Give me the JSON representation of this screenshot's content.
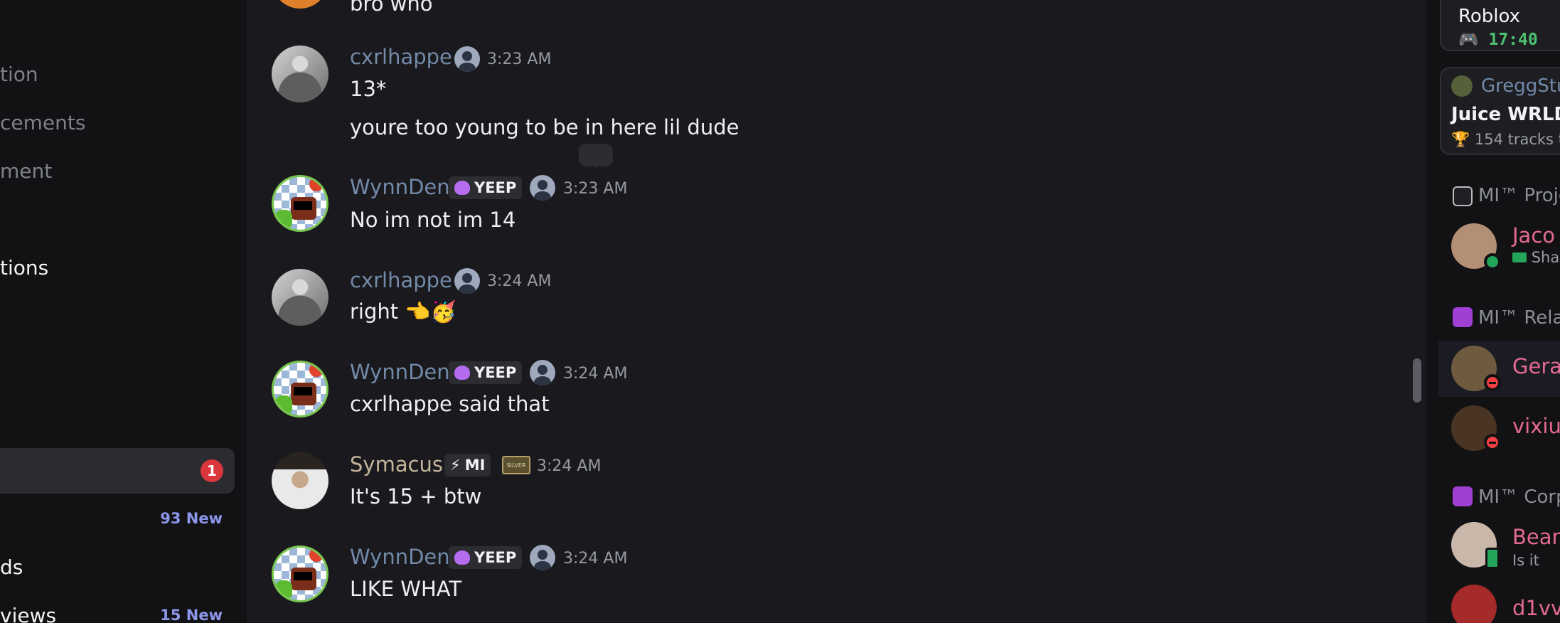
{
  "sidebar": {
    "items": [
      {
        "label": "tion"
      },
      {
        "label": "cements"
      },
      {
        "label": "ment"
      },
      {
        "label": "tions"
      },
      {
        "label": "ds"
      },
      {
        "label": "views"
      }
    ],
    "selected_badge": "1",
    "new_counts": [
      "93 New",
      "15 New"
    ]
  },
  "chat": {
    "messages": [
      {
        "author": "",
        "time": "",
        "lines": [
          "bro who"
        ]
      },
      {
        "author": "cxrlhappe",
        "time": "3:23 AM",
        "lines": [
          "13*",
          "youre too young to be in here lil dude"
        ]
      },
      {
        "author": "WynnDen",
        "tag": "YEEP",
        "time": "3:23 AM",
        "lines": [
          "No im not im 14"
        ]
      },
      {
        "author": "cxrlhappe",
        "time": "3:24 AM",
        "lines": [
          "right 👈🥳"
        ]
      },
      {
        "author": "WynnDen",
        "tag": "YEEP",
        "time": "3:24 AM",
        "lines": [
          "cxrlhappe said that"
        ]
      },
      {
        "author": "Symacus",
        "tag": "MI",
        "badge": "SILVER",
        "time": "3:24 AM",
        "lines": [
          "It's 15 + btw"
        ]
      },
      {
        "author": "WynnDen",
        "tag": "YEEP",
        "time": "3:24 AM",
        "lines": [
          "LIKE WHAT"
        ]
      }
    ]
  },
  "members": {
    "activity_card": {
      "game": "Roblox",
      "timer": "17:40"
    },
    "listening_card": {
      "user": "GreggStu",
      "title": "Juice WRLD",
      "subtitle": "154 tracks t"
    },
    "groups": [
      {
        "name": "MI™ Proje",
        "members": [
          {
            "name": "Jaco",
            "sub": "Sha",
            "status": "online"
          }
        ]
      },
      {
        "name": "MI™ Relat",
        "members": [
          {
            "name": "Gera",
            "status": "dnd"
          },
          {
            "name": "vixius",
            "status": "dnd"
          }
        ]
      },
      {
        "name": "MI™ Corp",
        "members": [
          {
            "name": "Bean",
            "sub": "Is it",
            "status": "mobile"
          },
          {
            "name": "d1vv",
            "status": "dnd"
          }
        ]
      }
    ]
  },
  "colors": {
    "background": "#1a1a1e",
    "sidebar": "#121214",
    "username": "#7289a8",
    "member_name": "#e56a92",
    "new_badge": "#8c96ea",
    "mention_badge": "#da373c"
  },
  "icons": [
    "person-icon",
    "heart-icon",
    "lightning-icon",
    "gamepad-icon",
    "trophy-icon",
    "screen-icon",
    "phone-icon"
  ]
}
